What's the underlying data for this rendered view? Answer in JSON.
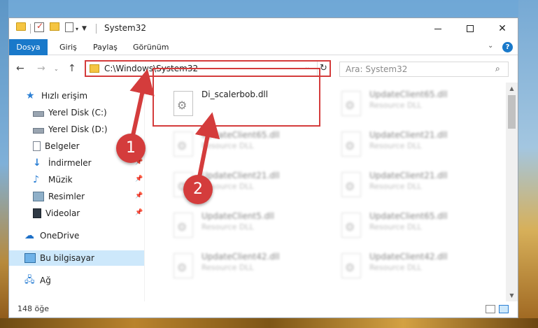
{
  "window": {
    "title": "System32"
  },
  "ribbon": {
    "tabs": [
      "Dosya",
      "Giriş",
      "Paylaş",
      "Görünüm"
    ]
  },
  "address": {
    "path": "C:\\Windows\\System32",
    "search_placeholder": "Ara: System32"
  },
  "sidebar": {
    "items": [
      {
        "label": "Hızlı erişim",
        "icon": "star-icon"
      },
      {
        "label": "Yerel Disk (C:)",
        "icon": "disk-icon"
      },
      {
        "label": "Yerel Disk (D:)",
        "icon": "disk-icon"
      },
      {
        "label": "Belgeler",
        "icon": "document-icon"
      },
      {
        "label": "İndirmeler",
        "icon": "download-icon"
      },
      {
        "label": "Müzik",
        "icon": "music-icon"
      },
      {
        "label": "Resimler",
        "icon": "pictures-icon"
      },
      {
        "label": "Videolar",
        "icon": "video-icon"
      },
      {
        "label": "OneDrive",
        "icon": "cloud-icon"
      },
      {
        "label": "Bu bilgisayar",
        "icon": "computer-icon"
      },
      {
        "label": "Ağ",
        "icon": "network-icon"
      }
    ],
    "selected": "Bu bilgisayar"
  },
  "files": {
    "highlighted": {
      "name": "Di_scalerbob.dll"
    },
    "items": [
      {
        "name": "UpdateClient65.dll",
        "type": "Resource DLL"
      },
      {
        "name": "UpdateClient65.dll",
        "type": "Resource DLL"
      },
      {
        "name": "UpdateClient21.dll",
        "type": "Resource DLL"
      },
      {
        "name": "UpdateClient21.dll",
        "type": "Resource DLL"
      },
      {
        "name": "UpdateClient21.dll",
        "type": "Resource DLL"
      },
      {
        "name": "UpdateClient5.dll",
        "type": "Resource DLL"
      },
      {
        "name": "UpdateClient65.dll",
        "type": "Resource DLL"
      },
      {
        "name": "UpdateClient42.dll",
        "type": "Resource DLL"
      },
      {
        "name": "UpdateClient42.dll",
        "type": "Resource DLL"
      }
    ]
  },
  "status": {
    "count": "148 öğe"
  },
  "annotations": {
    "step1": "1",
    "step2": "2",
    "color": "#d43c3c"
  }
}
